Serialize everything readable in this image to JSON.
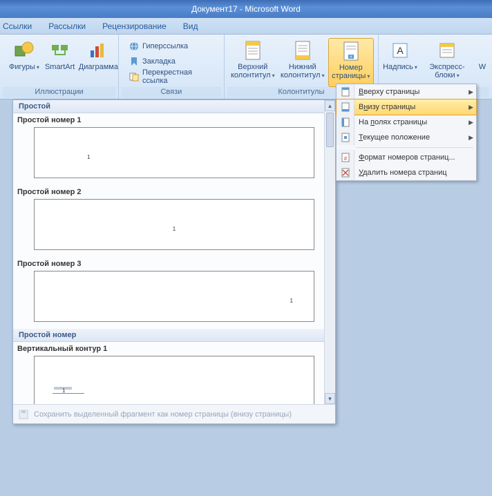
{
  "title": "Документ17 - Microsoft Word",
  "tabs": {
    "t1": "Ссылки",
    "t2": "Рассылки",
    "t3": "Рецензирование",
    "t4": "Вид"
  },
  "ribbon": {
    "group_illustrations": {
      "label": "Иллюстрации",
      "shapes": "Фигуры",
      "smartart": "SmartArt",
      "chart": "Диаграмма"
    },
    "group_links": {
      "label": "Связи",
      "hyperlink": "Гиперссылка",
      "bookmark": "Закладка",
      "crossref": "Перекрестная ссылка"
    },
    "group_headerfooter": {
      "label": "Колонтитулы",
      "header": "Верхний колонтитул",
      "footer": "Нижний колонтитул",
      "pagenum": "Номер страницы"
    },
    "group_text": {
      "textbox": "Надпись",
      "quickparts": "Экспресс-блоки",
      "wordart": "W"
    }
  },
  "menu": {
    "top": "Вверху страницы",
    "bottom": "Внизу страницы",
    "margins": "На полях страницы",
    "current": "Текущее положение",
    "format": "Формат номеров страниц...",
    "remove": "Удалить номера страниц",
    "acc": {
      "top": "В",
      "bottom": "н",
      "margins": "п",
      "current": "Т",
      "format": "Ф",
      "remove": "У"
    }
  },
  "gallery": {
    "h1": "Простой",
    "i1": "Простой номер 1",
    "i2": "Простой номер 2",
    "i3": "Простой номер 3",
    "h2": "Простой номер",
    "i4": "Вертикальный контур 1",
    "footer": "Сохранить выделенный фрагмент как номер страницы (внизу страницы)",
    "sample": "1"
  }
}
